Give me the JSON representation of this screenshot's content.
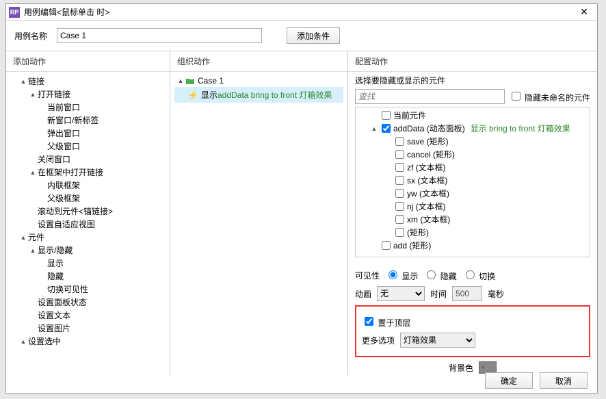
{
  "title": "用例编辑<鼠标单击 时>",
  "caseLabel": "用例名称",
  "caseName": "Case 1",
  "addCond": "添加条件",
  "hdrA": "添加动作",
  "hdrB": "组织动作",
  "hdrC": "配置动作",
  "treeA": [
    {
      "d": 1,
      "t": "▲",
      "x": "链接"
    },
    {
      "d": 2,
      "t": "▲",
      "x": "打开链接"
    },
    {
      "d": 3,
      "t": "",
      "x": "当前窗口"
    },
    {
      "d": 3,
      "t": "",
      "x": "新窗口/新标签"
    },
    {
      "d": 3,
      "t": "",
      "x": "弹出窗口"
    },
    {
      "d": 3,
      "t": "",
      "x": "父级窗口"
    },
    {
      "d": 2,
      "t": "",
      "x": "关闭窗口"
    },
    {
      "d": 2,
      "t": "▲",
      "x": "在框架中打开链接"
    },
    {
      "d": 3,
      "t": "",
      "x": "内联框架"
    },
    {
      "d": 3,
      "t": "",
      "x": "父级框架"
    },
    {
      "d": 2,
      "t": "",
      "x": "滚动到元件<锚链接>"
    },
    {
      "d": 2,
      "t": "",
      "x": "设置自适应视图"
    },
    {
      "d": 1,
      "t": "▲",
      "x": "元件"
    },
    {
      "d": 2,
      "t": "▲",
      "x": "显示/隐藏"
    },
    {
      "d": 3,
      "t": "",
      "x": "显示"
    },
    {
      "d": 3,
      "t": "",
      "x": "隐藏"
    },
    {
      "d": 3,
      "t": "",
      "x": "切换可见性"
    },
    {
      "d": 2,
      "t": "",
      "x": "设置面板状态"
    },
    {
      "d": 2,
      "t": "",
      "x": "设置文本"
    },
    {
      "d": 2,
      "t": "",
      "x": "设置图片"
    },
    {
      "d": 1,
      "t": "▲",
      "x": "设置选中"
    }
  ],
  "caseRow": "Case 1",
  "actShow": "显示 ",
  "actGreen": "addData bring to front 灯箱效果",
  "selHdr": "选择要隐藏或显示的元件",
  "searchPh": "查找",
  "hideUnnamed": "隐藏未命名的元件",
  "widgets": [
    {
      "d": 1,
      "c": false,
      "x": "当前元件",
      "g": ""
    },
    {
      "d": 1,
      "c": true,
      "x": "addData (动态面板)",
      "g": "显示 bring to front 灯箱效果"
    },
    {
      "d": 2,
      "c": false,
      "x": "save (矩形)",
      "g": ""
    },
    {
      "d": 2,
      "c": false,
      "x": "cancel (矩形)",
      "g": ""
    },
    {
      "d": 2,
      "c": false,
      "x": "zf (文本框)",
      "g": ""
    },
    {
      "d": 2,
      "c": false,
      "x": "sx (文本框)",
      "g": ""
    },
    {
      "d": 2,
      "c": false,
      "x": "yw (文本框)",
      "g": ""
    },
    {
      "d": 2,
      "c": false,
      "x": "nj (文本框)",
      "g": ""
    },
    {
      "d": 2,
      "c": false,
      "x": "xm (文本框)",
      "g": ""
    },
    {
      "d": 2,
      "c": false,
      "x": "(矩形)",
      "g": ""
    },
    {
      "d": 1,
      "c": false,
      "x": "add (矩形)",
      "g": ""
    }
  ],
  "visLbl": "可见性",
  "visOpts": [
    "显示",
    "隐藏",
    "切换"
  ],
  "animLbl": "动画",
  "animVal": "无",
  "timeLbl": "时间",
  "timeVal": "500",
  "msLbl": "毫秒",
  "bringTop": "置于顶层",
  "moreLbl": "更多选项",
  "moreVal": "灯箱效果",
  "bgLbl": "背景色",
  "ok": "确定",
  "cancel": "取消"
}
